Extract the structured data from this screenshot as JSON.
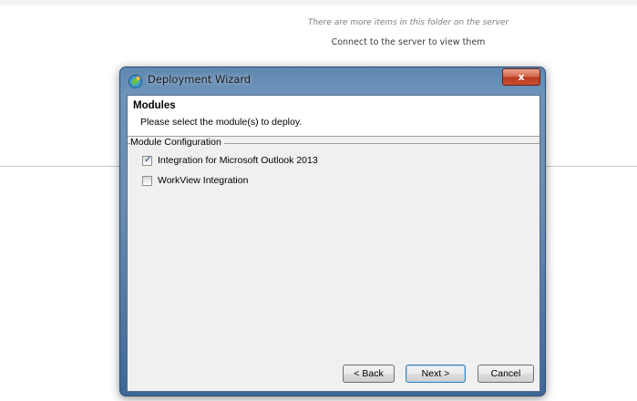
{
  "background": {
    "message_line1": "There are more items in this folder on the server",
    "message_line2": "Connect to the server to view them"
  },
  "dialog": {
    "title": "Deployment Wizard",
    "close_label": "x",
    "icon": "wizard-app-icon",
    "header": {
      "title": "Modules",
      "subtitle": "Please select the module(s) to deploy."
    },
    "group": {
      "label": "Module Configuration",
      "options": [
        {
          "label": "Integration for Microsoft Outlook 2013",
          "checked": true,
          "check_glyph": "✓"
        },
        {
          "label": "WorkView Integration",
          "checked": false,
          "check_glyph": ""
        }
      ]
    },
    "buttons": {
      "back": "< Back",
      "next": "Next >",
      "cancel": "Cancel"
    }
  },
  "colors": {
    "title_bar": "#6b8db1",
    "close_button": "#c45033",
    "client_background": "#f0f0f0"
  }
}
